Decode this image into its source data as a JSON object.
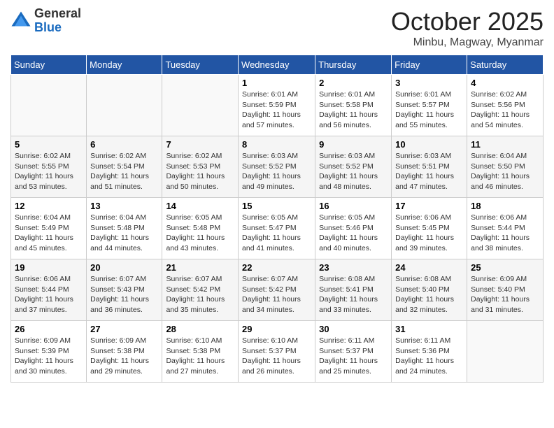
{
  "header": {
    "logo_general": "General",
    "logo_blue": "Blue",
    "month": "October 2025",
    "location": "Minbu, Magway, Myanmar"
  },
  "weekdays": [
    "Sunday",
    "Monday",
    "Tuesday",
    "Wednesday",
    "Thursday",
    "Friday",
    "Saturday"
  ],
  "weeks": [
    [
      {
        "day": "",
        "info": ""
      },
      {
        "day": "",
        "info": ""
      },
      {
        "day": "",
        "info": ""
      },
      {
        "day": "1",
        "info": "Sunrise: 6:01 AM\nSunset: 5:59 PM\nDaylight: 11 hours and 57 minutes."
      },
      {
        "day": "2",
        "info": "Sunrise: 6:01 AM\nSunset: 5:58 PM\nDaylight: 11 hours and 56 minutes."
      },
      {
        "day": "3",
        "info": "Sunrise: 6:01 AM\nSunset: 5:57 PM\nDaylight: 11 hours and 55 minutes."
      },
      {
        "day": "4",
        "info": "Sunrise: 6:02 AM\nSunset: 5:56 PM\nDaylight: 11 hours and 54 minutes."
      }
    ],
    [
      {
        "day": "5",
        "info": "Sunrise: 6:02 AM\nSunset: 5:55 PM\nDaylight: 11 hours and 53 minutes."
      },
      {
        "day": "6",
        "info": "Sunrise: 6:02 AM\nSunset: 5:54 PM\nDaylight: 11 hours and 51 minutes."
      },
      {
        "day": "7",
        "info": "Sunrise: 6:02 AM\nSunset: 5:53 PM\nDaylight: 11 hours and 50 minutes."
      },
      {
        "day": "8",
        "info": "Sunrise: 6:03 AM\nSunset: 5:52 PM\nDaylight: 11 hours and 49 minutes."
      },
      {
        "day": "9",
        "info": "Sunrise: 6:03 AM\nSunset: 5:52 PM\nDaylight: 11 hours and 48 minutes."
      },
      {
        "day": "10",
        "info": "Sunrise: 6:03 AM\nSunset: 5:51 PM\nDaylight: 11 hours and 47 minutes."
      },
      {
        "day": "11",
        "info": "Sunrise: 6:04 AM\nSunset: 5:50 PM\nDaylight: 11 hours and 46 minutes."
      }
    ],
    [
      {
        "day": "12",
        "info": "Sunrise: 6:04 AM\nSunset: 5:49 PM\nDaylight: 11 hours and 45 minutes."
      },
      {
        "day": "13",
        "info": "Sunrise: 6:04 AM\nSunset: 5:48 PM\nDaylight: 11 hours and 44 minutes."
      },
      {
        "day": "14",
        "info": "Sunrise: 6:05 AM\nSunset: 5:48 PM\nDaylight: 11 hours and 43 minutes."
      },
      {
        "day": "15",
        "info": "Sunrise: 6:05 AM\nSunset: 5:47 PM\nDaylight: 11 hours and 41 minutes."
      },
      {
        "day": "16",
        "info": "Sunrise: 6:05 AM\nSunset: 5:46 PM\nDaylight: 11 hours and 40 minutes."
      },
      {
        "day": "17",
        "info": "Sunrise: 6:06 AM\nSunset: 5:45 PM\nDaylight: 11 hours and 39 minutes."
      },
      {
        "day": "18",
        "info": "Sunrise: 6:06 AM\nSunset: 5:44 PM\nDaylight: 11 hours and 38 minutes."
      }
    ],
    [
      {
        "day": "19",
        "info": "Sunrise: 6:06 AM\nSunset: 5:44 PM\nDaylight: 11 hours and 37 minutes."
      },
      {
        "day": "20",
        "info": "Sunrise: 6:07 AM\nSunset: 5:43 PM\nDaylight: 11 hours and 36 minutes."
      },
      {
        "day": "21",
        "info": "Sunrise: 6:07 AM\nSunset: 5:42 PM\nDaylight: 11 hours and 35 minutes."
      },
      {
        "day": "22",
        "info": "Sunrise: 6:07 AM\nSunset: 5:42 PM\nDaylight: 11 hours and 34 minutes."
      },
      {
        "day": "23",
        "info": "Sunrise: 6:08 AM\nSunset: 5:41 PM\nDaylight: 11 hours and 33 minutes."
      },
      {
        "day": "24",
        "info": "Sunrise: 6:08 AM\nSunset: 5:40 PM\nDaylight: 11 hours and 32 minutes."
      },
      {
        "day": "25",
        "info": "Sunrise: 6:09 AM\nSunset: 5:40 PM\nDaylight: 11 hours and 31 minutes."
      }
    ],
    [
      {
        "day": "26",
        "info": "Sunrise: 6:09 AM\nSunset: 5:39 PM\nDaylight: 11 hours and 30 minutes."
      },
      {
        "day": "27",
        "info": "Sunrise: 6:09 AM\nSunset: 5:38 PM\nDaylight: 11 hours and 29 minutes."
      },
      {
        "day": "28",
        "info": "Sunrise: 6:10 AM\nSunset: 5:38 PM\nDaylight: 11 hours and 27 minutes."
      },
      {
        "day": "29",
        "info": "Sunrise: 6:10 AM\nSunset: 5:37 PM\nDaylight: 11 hours and 26 minutes."
      },
      {
        "day": "30",
        "info": "Sunrise: 6:11 AM\nSunset: 5:37 PM\nDaylight: 11 hours and 25 minutes."
      },
      {
        "day": "31",
        "info": "Sunrise: 6:11 AM\nSunset: 5:36 PM\nDaylight: 11 hours and 24 minutes."
      },
      {
        "day": "",
        "info": ""
      }
    ]
  ]
}
